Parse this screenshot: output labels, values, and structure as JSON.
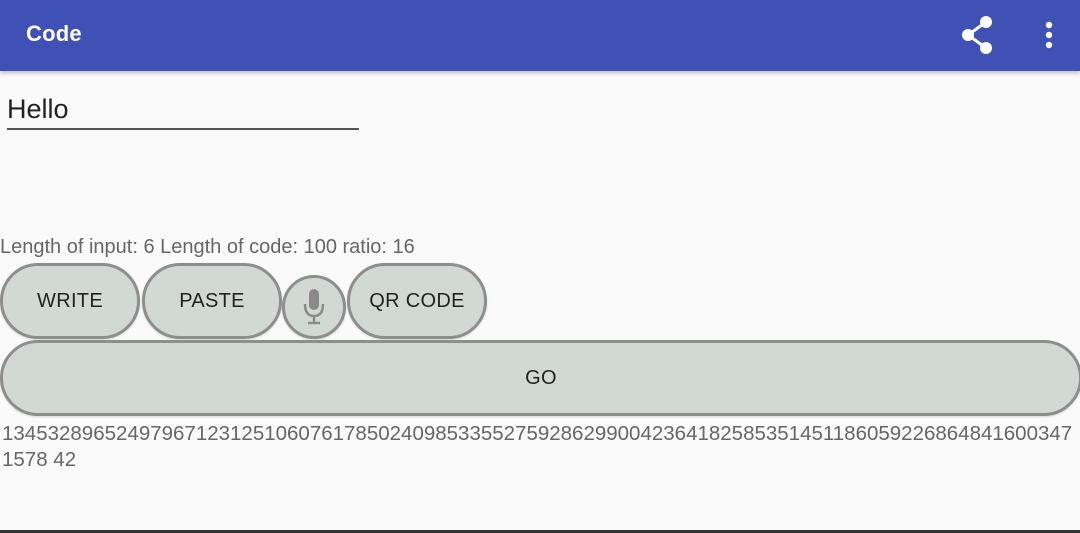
{
  "app_bar": {
    "title": "Code",
    "background_color": "#3f51b5",
    "actions": [
      {
        "icon": "share-icon"
      },
      {
        "icon": "more-vertical-icon"
      }
    ]
  },
  "input": {
    "value": "Hello"
  },
  "stats": {
    "text": "Length of input: 6 Length of code: 100 ratio: 16"
  },
  "buttons": {
    "write": "WRITE",
    "paste": "PASTE",
    "mic_icon": "microphone-icon",
    "qr_code": "QR CODE",
    "go": "GO",
    "color": "#d2d9d4"
  },
  "result": {
    "text": "13453289652497967123125106076178502409853355275928629900423641825853514511860592268648416003471578 42"
  }
}
